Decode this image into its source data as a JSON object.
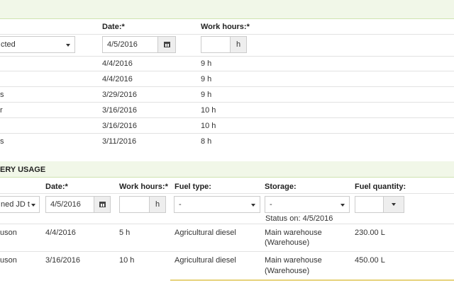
{
  "work": {
    "headers": {
      "date": "Date:*",
      "hours": "Work hours:*"
    },
    "form": {
      "select_value": "cted",
      "date_value": "4/5/2016",
      "hours_unit": "h"
    },
    "rows": [
      {
        "name": "",
        "date": "4/4/2016",
        "hours": "9 h"
      },
      {
        "name": "",
        "date": "4/4/2016",
        "hours": "9 h"
      },
      {
        "name": "s",
        "date": "3/29/2016",
        "hours": "9 h"
      },
      {
        "name": "r",
        "date": "3/16/2016",
        "hours": "10 h"
      },
      {
        "name": "",
        "date": "3/16/2016",
        "hours": "10 h"
      },
      {
        "name": "s",
        "date": "3/11/2016",
        "hours": "8 h"
      }
    ]
  },
  "machinery": {
    "title": "ERY USAGE",
    "headers": {
      "date": "Date:*",
      "hours": "Work hours:*",
      "fuel_type": "Fuel type:",
      "storage": "Storage:",
      "fuel_qty": "Fuel quantity:"
    },
    "form": {
      "machine_value": "ned JD t",
      "date_value": "4/5/2016",
      "hours_unit": "h",
      "fuel_type_value": "-",
      "storage_value": "-",
      "status": "Status on: 4/5/2016"
    },
    "rows": [
      {
        "name": "uson",
        "date": "4/4/2016",
        "hours": "5 h",
        "fuel_type": "Agricultural diesel",
        "storage_line1": "Main warehouse",
        "storage_line2": "(Warehouse)",
        "qty": "230.00 L"
      },
      {
        "name": "uson",
        "date": "3/16/2016",
        "hours": "10 h",
        "fuel_type": "Agricultural diesel",
        "storage_line1": "Main warehouse",
        "storage_line2": "(Warehouse)",
        "qty": "450.00 L"
      }
    ]
  }
}
